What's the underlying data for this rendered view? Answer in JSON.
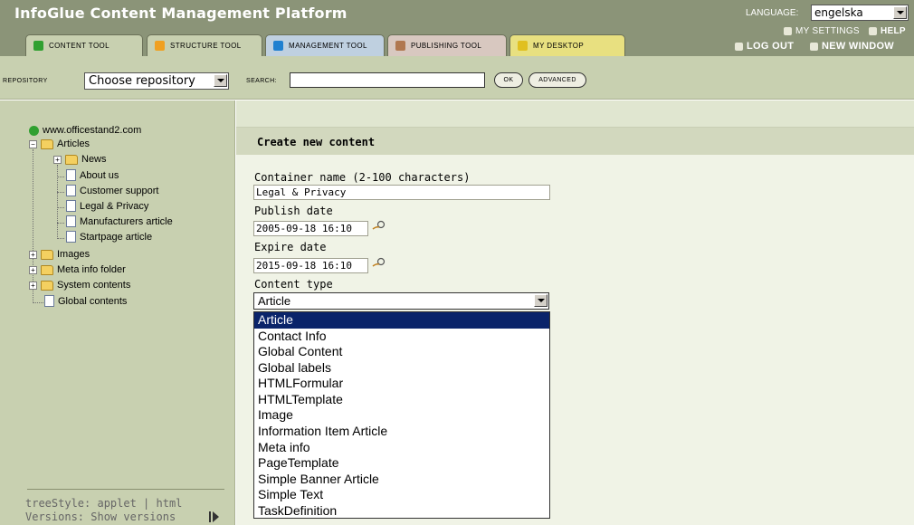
{
  "header": {
    "app_title": "InfoGlue Content Management Platform",
    "language_label": "LANGUAGE:",
    "language_value": "engelska",
    "links": {
      "my_settings": "MY SETTINGS",
      "help": "HELP",
      "log_out": "LOG OUT",
      "new_window": "NEW WINDOW"
    },
    "tabs": [
      {
        "label": "CONTENT TOOL",
        "icon": "green-cube-icon",
        "color": "#30a030"
      },
      {
        "label": "STRUCTURE TOOL",
        "icon": "orange-cube-icon",
        "color": "#f0a020"
      },
      {
        "label": "MANAGEMENT TOOL",
        "icon": "blue-cube-icon",
        "color": "#2080d0"
      },
      {
        "label": "PUBLISHING TOOL",
        "icon": "brown-cube-icon",
        "color": "#b07850"
      },
      {
        "label": "MY DESKTOP",
        "icon": "yellow-cube-icon",
        "color": "#e0c020"
      }
    ]
  },
  "toolbar": {
    "repository_label": "REPOSITORY",
    "repository_value": "Choose repository",
    "search_label": "SEARCH:",
    "search_value": "",
    "ok_label": "OK",
    "advanced_label": "ADVANCED"
  },
  "sidebar": {
    "tree": [
      {
        "label": "www.officestand2.com",
        "icon": "site-icon"
      },
      {
        "label": "Articles",
        "icon": "folder-icon",
        "expander": "−"
      },
      {
        "label": "News",
        "icon": "folder-icon",
        "expander": "+"
      },
      {
        "label": "About us",
        "icon": "document-icon"
      },
      {
        "label": "Customer support",
        "icon": "document-icon"
      },
      {
        "label": "Legal & Privacy",
        "icon": "document-icon"
      },
      {
        "label": "Manufacturers article",
        "icon": "document-icon"
      },
      {
        "label": "Startpage article",
        "icon": "document-icon"
      },
      {
        "label": "Images",
        "icon": "folder-icon",
        "expander": "+"
      },
      {
        "label": "Meta info folder",
        "icon": "folder-icon",
        "expander": "+"
      },
      {
        "label": "System contents",
        "icon": "folder-icon",
        "expander": "+"
      },
      {
        "label": "Global contents",
        "icon": "document-icon"
      }
    ],
    "tree_style": "treeStyle: applet | html",
    "versions": "Versions: Show versions"
  },
  "form": {
    "title": "Create new content",
    "container_name_label": "Container name (2-100 characters)",
    "container_name_value": "Legal & Privacy",
    "publish_date_label": "Publish date",
    "publish_date_value": "2005-09-18 16:10",
    "expire_date_label": "Expire date",
    "expire_date_value": "2015-09-18 16:10",
    "content_type_label": "Content type",
    "content_type_value": "Article",
    "content_type_options": [
      "Article",
      "Contact Info",
      "Global Content",
      "Global labels",
      "HTMLFormular",
      "HTMLTemplate",
      "Image",
      "Information Item Article",
      "Meta info",
      "PageTemplate",
      "Simple Banner Article",
      "Simple Text",
      "TaskDefinition"
    ]
  }
}
